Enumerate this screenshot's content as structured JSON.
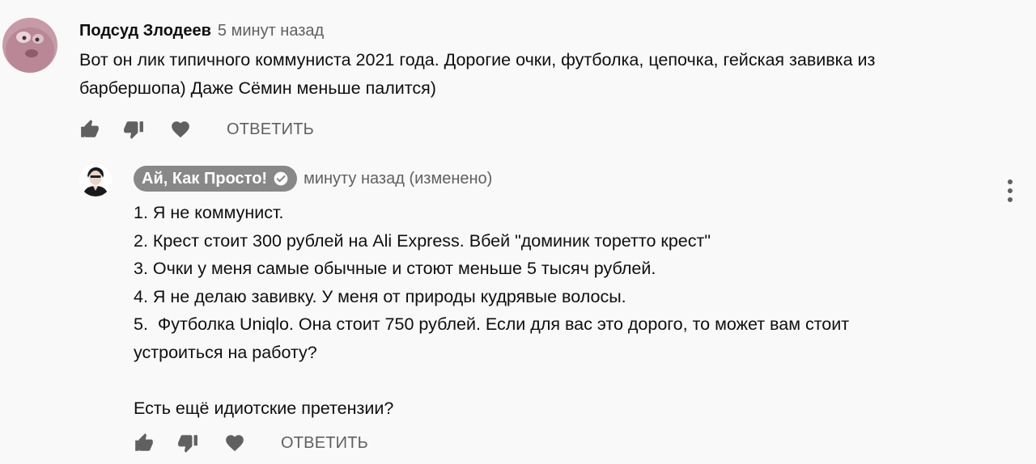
{
  "comments": [
    {
      "author": "Подсуд Злодеев",
      "time": "5 минут назад",
      "text": "Вот он лик типичного коммуниста 2021 года. Дорогие очки, футболка, цепочка, гейская завивка из\nбарбершопа) Даже Сёмин меньше палится)",
      "reply_label": "ОТВЕТИТЬ"
    },
    {
      "author": "Ай, Как Просто!",
      "time": "минуту назад (изменено)",
      "text": "1. Я не коммунист.\n2. Крест стоит 300 рублей на Ali Express. Вбей \"доминик торетто крест\"\n3. Очки у меня самые обычные и стоют меньше 5 тысяч рублей.\n4. Я не делаю завивку. У меня от природы кудрявые волосы.\n5.  Футболка Uniqlo. Она стоит 750 рублей. Если для вас это дорого, то может вам стоит\nустроиться на работу?\n\nЕсть ещё идиотские претензии?",
      "reply_label": "ОТВЕТИТЬ"
    }
  ],
  "icons": {
    "like": "thumb-up-icon",
    "dislike": "thumb-down-icon",
    "heart": "heart-icon",
    "menu": "more-vert-icon",
    "verified": "verified-check-icon"
  },
  "colors": {
    "background": "#f9f9f9",
    "author_badge": "#888888",
    "secondary_text": "#606060"
  }
}
